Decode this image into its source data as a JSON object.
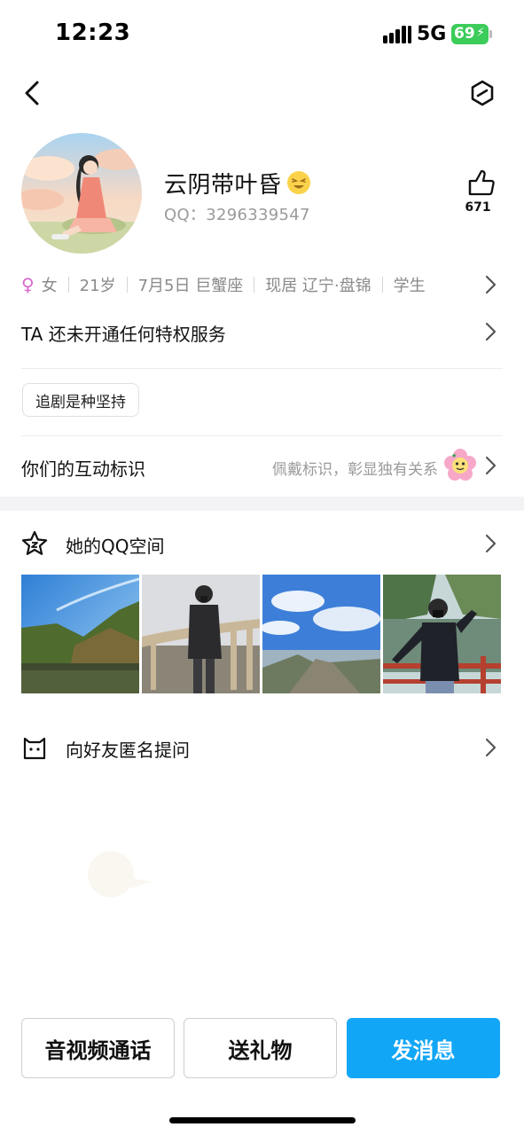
{
  "status_bar": {
    "time": "12:23",
    "network": "5G",
    "battery": "69",
    "battery_color": "#3ccc5a"
  },
  "nav": {
    "back_icon": "chevron-left-icon",
    "menu_icon": "hexagon-menu-icon"
  },
  "profile": {
    "nickname": "云阴带叶昏",
    "emoji_icon": "grinning-emoji-icon",
    "qq_label": "QQ：",
    "qq_number": "3296339547",
    "like_icon": "thumbs-up-icon",
    "like_count": "671"
  },
  "info": {
    "gender_symbol": "♀",
    "gender": "女",
    "age": "21岁",
    "birthday": "7月5日 巨蟹座",
    "location": "现居 辽宁·盘锦",
    "occupation": "学生",
    "gender_color": "#d968cc"
  },
  "privilege": {
    "text": "TA 还未开通任何特权服务"
  },
  "tags": [
    {
      "label": "追剧是种坚持"
    }
  ],
  "interaction": {
    "label": "你们的互动标识",
    "hint": "佩戴标识，彰显独有关系",
    "badge_icon": "flower-badge-icon"
  },
  "qzone": {
    "icon": "star-icon",
    "label": "她的QQ空间",
    "photos": [
      {
        "name": "mountain-lake-photo"
      },
      {
        "name": "girl-railing-photo"
      },
      {
        "name": "mountain-peak-sky-photo"
      },
      {
        "name": "girl-waving-lake-photo"
      }
    ]
  },
  "anonymous": {
    "icon": "cat-box-icon",
    "label": "向好友匿名提问"
  },
  "actions": {
    "call": "音视频通话",
    "gift": "送礼物",
    "message": "发消息",
    "accent_color": "#12a6f6"
  }
}
